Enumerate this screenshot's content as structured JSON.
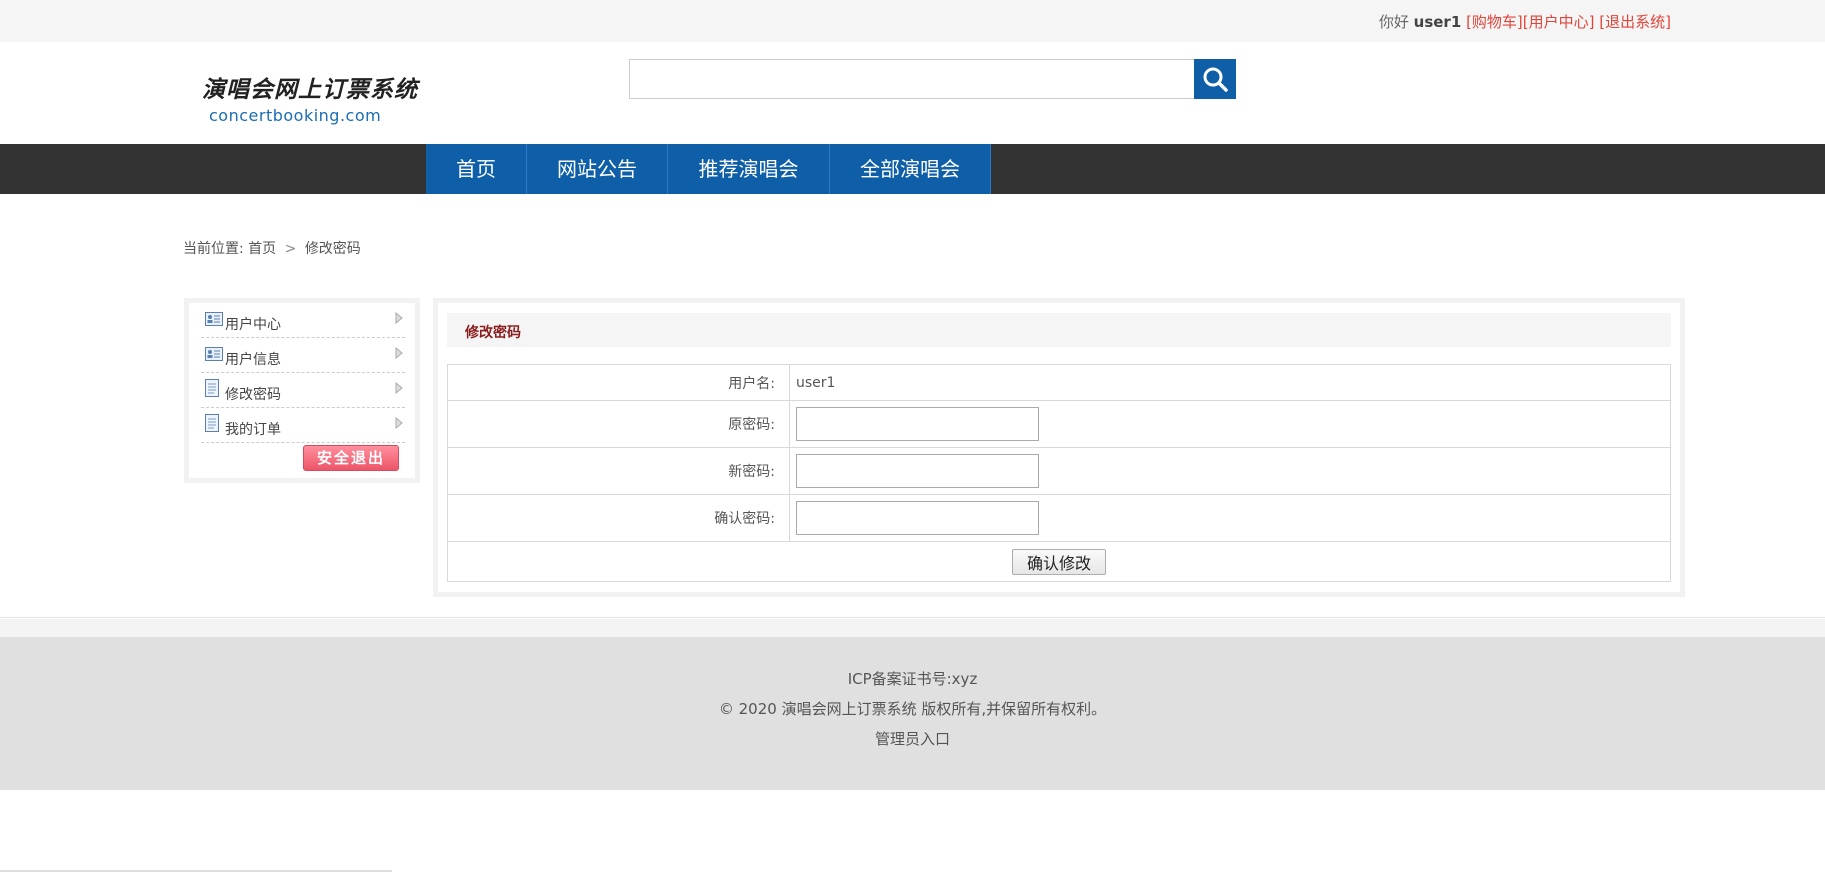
{
  "topbar": {
    "greeting": "你好",
    "username": "user1",
    "links": [
      "[购物车]",
      "[用户中心]",
      "[退出系统]"
    ]
  },
  "header": {
    "logo_cn": "演唱会网上订票系统",
    "logo_en": "concertbooking.com",
    "search": {
      "value": "",
      "placeholder": ""
    }
  },
  "nav": {
    "items": [
      "首页",
      "网站公告",
      "推荐演唱会",
      "全部演唱会"
    ]
  },
  "breadcrumb": {
    "prefix": "当前位置:",
    "home": "首页",
    "separator": ">",
    "current": "修改密码"
  },
  "sidebar": {
    "items": [
      {
        "label": "用户中心",
        "icon": "id-card-icon"
      },
      {
        "label": "用户信息",
        "icon": "id-card-icon"
      },
      {
        "label": "修改密码",
        "icon": "document-icon"
      },
      {
        "label": "我的订单",
        "icon": "document-icon"
      }
    ],
    "logout_label": "安全退出"
  },
  "panel": {
    "title": "修改密码",
    "fields": {
      "username_label": "用户名:",
      "username_value": "user1",
      "old_password_label": "原密码:",
      "new_password_label": "新密码:",
      "confirm_password_label": "确认密码:"
    },
    "submit_label": "确认修改"
  },
  "footer": {
    "icp": "ICP备案证书号:xyz",
    "copyright": "© 2020 演唱会网上订票系统 版权所有,并保留所有权利。",
    "admin_link": "管理员入口"
  },
  "colors": {
    "brand_blue": "#0e5ea8",
    "nav_dark": "#333333",
    "link_red": "#e0453a",
    "panel_title": "#8a1c1c"
  }
}
